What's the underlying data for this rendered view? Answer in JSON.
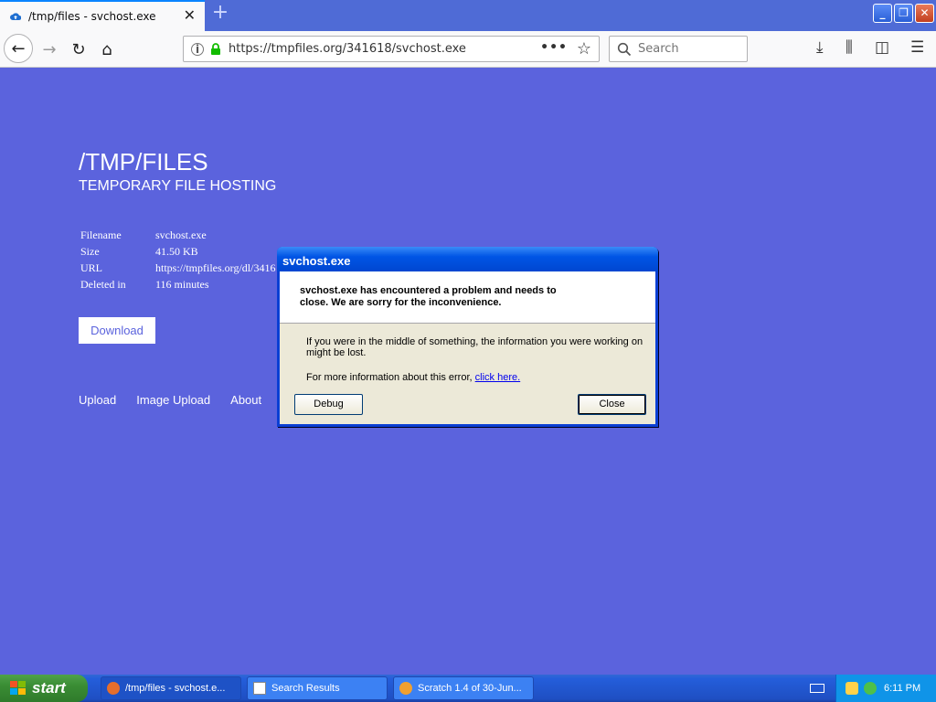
{
  "browser": {
    "tab_title": "/tmp/files - svchost.exe",
    "url": "https://tmpfiles.org/341618/svchost.exe",
    "search_placeholder": "Search"
  },
  "page": {
    "title": "/TMP/FILES",
    "subtitle": "TEMPORARY FILE HOSTING",
    "file_info": [
      {
        "key": "Filename",
        "value": "svchost.exe"
      },
      {
        "key": "Size",
        "value": "41.50 KB"
      },
      {
        "key": "URL",
        "value": "https://tmpfiles.org/dl/3416"
      },
      {
        "key": "Deleted in",
        "value": "116 minutes"
      }
    ],
    "download_label": "Download",
    "footer_links": [
      "Upload",
      "Image Upload",
      "About"
    ]
  },
  "dialog": {
    "title": "svchost.exe",
    "message_line1": "svchost.exe has encountered a problem and needs to",
    "message_line2": "close.  We are sorry for the inconvenience.",
    "body_line1": "If you were in the middle of something, the information you were working on",
    "body_line2": "might be lost.",
    "more_info_prefix": "For more information about this error, ",
    "more_info_link": "click here.",
    "debug_label": "Debug",
    "close_label": "Close"
  },
  "taskbar": {
    "start_label": "start",
    "tasks": [
      "/tmp/files - svchost.e...",
      "Search Results",
      "Scratch 1.4 of 30-Jun..."
    ],
    "clock": "6:11 PM"
  }
}
